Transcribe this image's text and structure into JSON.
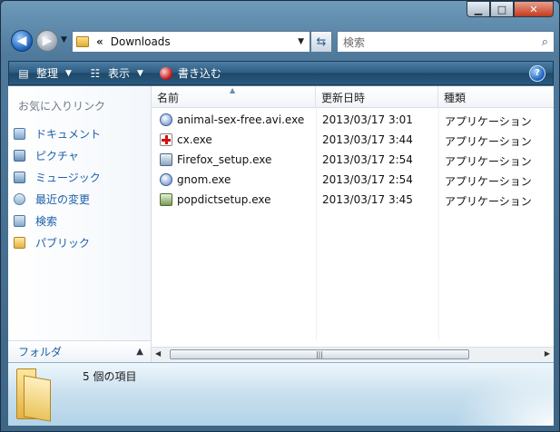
{
  "address": {
    "chevrons": "«",
    "path": "Downloads"
  },
  "search": {
    "placeholder": "検索"
  },
  "toolbar": {
    "organize": "整理",
    "views": "表示",
    "burn": "書き込む"
  },
  "left_pane": {
    "title": "お気に入りリンク",
    "items": [
      {
        "label": "ドキュメント",
        "icon": "documents-icon"
      },
      {
        "label": "ピクチャ",
        "icon": "pictures-icon"
      },
      {
        "label": "ミュージック",
        "icon": "music-icon"
      },
      {
        "label": "最近の変更",
        "icon": "recent-changes-icon"
      },
      {
        "label": "検索",
        "icon": "searches-icon"
      },
      {
        "label": "パブリック",
        "icon": "public-folder-icon"
      }
    ],
    "folders_label": "フォルダ"
  },
  "columns": {
    "name": "名前",
    "date": "更新日時",
    "type": "種類"
  },
  "files": [
    {
      "name": "animal-sex-free.avi.exe",
      "date": "2013/03/17 3:01",
      "type": "アプリケーション",
      "icon": "setup-info-icon"
    },
    {
      "name": "cx.exe",
      "date": "2013/03/17 3:44",
      "type": "アプリケーション",
      "icon": "red-cross-icon"
    },
    {
      "name": "Firefox_setup.exe",
      "date": "2013/03/17 2:54",
      "type": "アプリケーション",
      "icon": "installer-icon"
    },
    {
      "name": "gnom.exe",
      "date": "2013/03/17 2:54",
      "type": "アプリケーション",
      "icon": "setup-info-icon"
    },
    {
      "name": "popdictsetup.exe",
      "date": "2013/03/17 3:45",
      "type": "アプリケーション",
      "icon": "package-icon"
    }
  ],
  "details": {
    "count": "5 個の項目"
  }
}
